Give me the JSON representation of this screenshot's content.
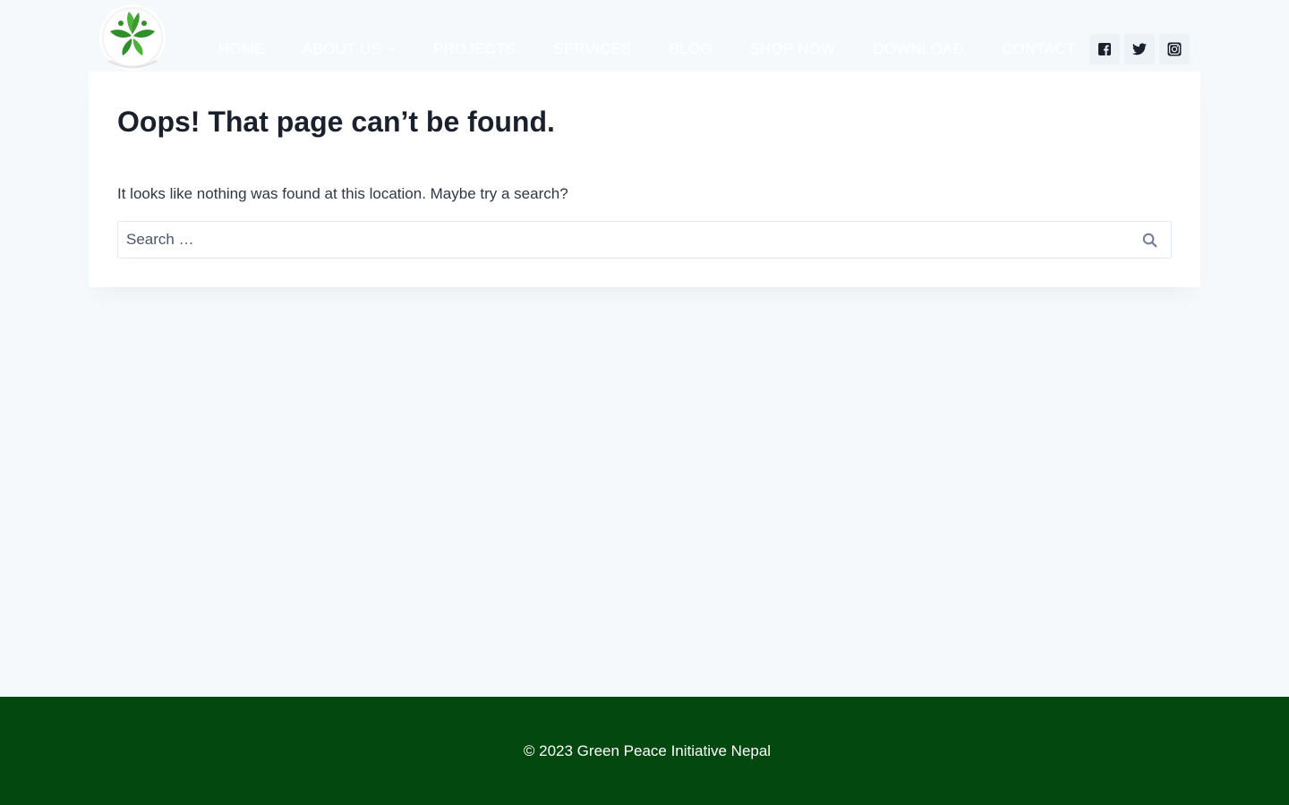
{
  "header": {
    "nav": [
      {
        "label": "HOME"
      },
      {
        "label": "ABOUT US"
      },
      {
        "label": "PROJECTS"
      },
      {
        "label": "SERVICES"
      },
      {
        "label": "BLOG"
      },
      {
        "label": "SHOP NOW"
      },
      {
        "label": "DOWNLOAD"
      },
      {
        "label": "CONTACT"
      }
    ],
    "social": [
      "facebook-icon",
      "twitter-icon",
      "instagram-icon"
    ]
  },
  "main": {
    "title": "Oops! That page can’t be found.",
    "message": "It looks like nothing was found at this location. Maybe try a search?",
    "search": {
      "placeholder": "Search …",
      "value": ""
    }
  },
  "footer": {
    "copyright": "© 2023 Green Peace Initiative Nepal"
  },
  "colors": {
    "background": "#f6f9fc",
    "footer": "#03480e",
    "logo_green": "#3a9b2f",
    "text_dark": "#1a202c"
  }
}
